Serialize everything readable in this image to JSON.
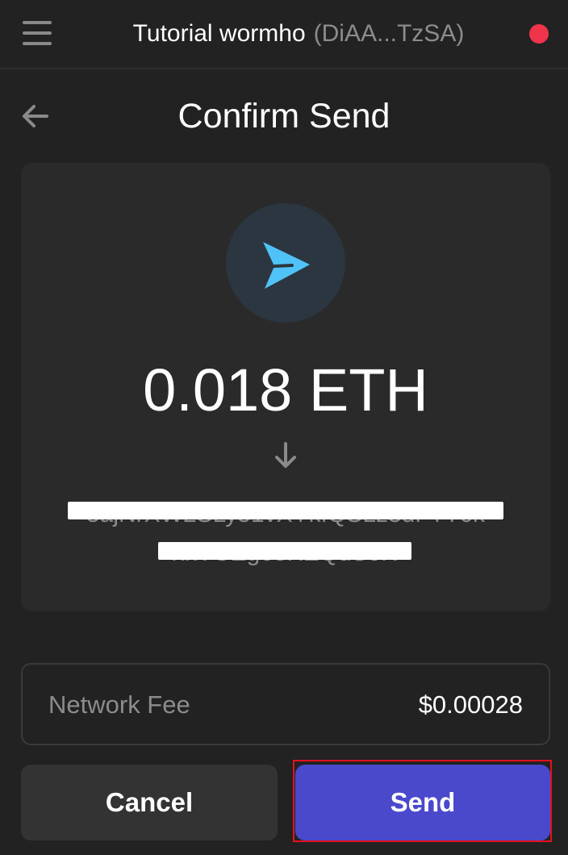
{
  "header": {
    "wallet_name": "Tutorial wormho",
    "wallet_address": "(DiAA...TzSA)",
    "menu_icon": "hamburger-menu-icon",
    "status_icon": "status-dot-icon",
    "status_color": "#f0344b"
  },
  "page": {
    "title": "Confirm Send",
    "back_icon": "back-arrow-icon"
  },
  "summary": {
    "send_icon": "paper-plane-icon",
    "amount": "0.018 ETH",
    "direction_icon": "down-arrow-icon",
    "recipient_line1": "5ajNrXW2SLy51vXYkfQSLz3dFTT6k",
    "recipient_line2": "xkVCEg6oKEQdSoN",
    "recipient_redacted": true
  },
  "network_fee": {
    "label": "Network Fee",
    "value": "$0.00028"
  },
  "actions": {
    "cancel_label": "Cancel",
    "send_label": "Send"
  },
  "colors": {
    "background": "#222222",
    "card": "#2a2a2a",
    "accent": "#4a49cc",
    "send_icon": "#4fc3f7",
    "highlight_outline": "#e5101e"
  }
}
